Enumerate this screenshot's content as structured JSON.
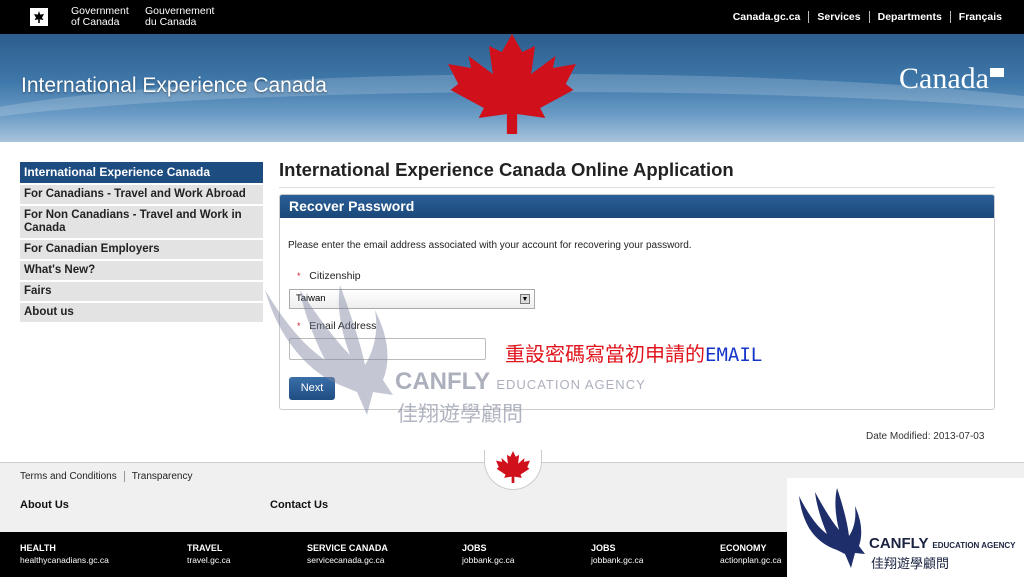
{
  "topbar": {
    "gov_en_line1": "Government",
    "gov_en_line2": "of Canada",
    "gov_fr_line1": "Gouvernement",
    "gov_fr_line2": "du Canada",
    "links": [
      "Canada.gc.ca",
      "Services",
      "Departments",
      "Français"
    ]
  },
  "banner": {
    "title": "International Experience Canada",
    "wordmark": "Canada"
  },
  "sidebar": {
    "items": [
      {
        "label": "International Experience Canada",
        "active": true
      },
      {
        "label": "For Canadians - Travel and Work Abroad"
      },
      {
        "label": "For Non Canadians - Travel and Work in Canada"
      },
      {
        "label": "For Canadian Employers"
      },
      {
        "label": "What's New?"
      },
      {
        "label": "Fairs"
      },
      {
        "label": "About us"
      }
    ]
  },
  "main": {
    "title": "International Experience Canada Online Application",
    "panel_title": "Recover Password",
    "instructions": "Please enter the email address associated with your account for recovering your password.",
    "required_mark": "*",
    "citizenship_label": "Citizenship",
    "citizenship_value": "Taiwan",
    "email_label": "Email Address",
    "email_value": "",
    "next_label": "Next",
    "date_modified": "Date Modified: 2013-07-03"
  },
  "annotation": {
    "zh": "重設密碼寫當初申請的",
    "en": "EMAIL"
  },
  "watermark": {
    "brand": "CANFLY",
    "brand_suffix": "EDUCATION AGENCY",
    "zh": "佳翔遊學顧問"
  },
  "footer": {
    "links": [
      "Terms and Conditions",
      "Transparency"
    ],
    "about": "About Us",
    "contact": "Contact Us",
    "columns": [
      {
        "heading": "HEALTH",
        "url": "healthycanadians.gc.ca"
      },
      {
        "heading": "TRAVEL",
        "url": "travel.gc.ca"
      },
      {
        "heading": "SERVICE CANADA",
        "url": "servicecanada.gc.ca"
      },
      {
        "heading": "JOBS",
        "url": "jobbank.gc.ca"
      },
      {
        "heading": "JOBS",
        "url": "jobbank.gc.ca"
      },
      {
        "heading": "ECONOMY",
        "url": "actionplan.gc.ca"
      }
    ]
  },
  "logo": {
    "brand": "CANFLY",
    "brand_suffix": "EDUCATION AGENCY",
    "zh": "佳翔遊學顧問"
  }
}
